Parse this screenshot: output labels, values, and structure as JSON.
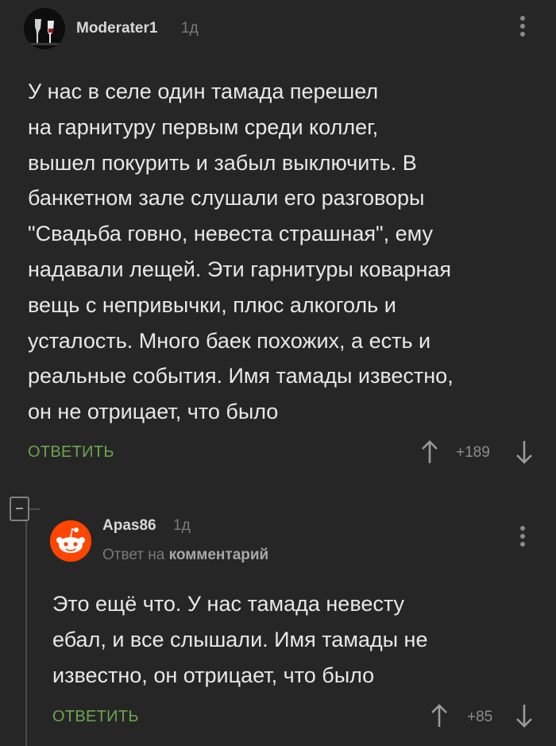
{
  "comments": [
    {
      "author": "Moderater1",
      "age": "1д",
      "text_lines": [
        "У нас в селе один тамада перешел",
        "на гарнитуру первым среди коллег,",
        "вышел покурить и забыл выключить. В",
        "банкетном зале слушали его разговоры",
        "\"Свадьба говно, невеста страшная\", ему",
        "надавали лещей. Эти гарнитуры коварная",
        "вещь с непривычки, плюс алкоголь и",
        "усталость. Много баек похожих, а есть и",
        "реальные события. Имя тамады известно,",
        "он не отрицает, что было"
      ],
      "reply_label": "ОТВЕТИТЬ",
      "score": "+189"
    },
    {
      "author": "Apas86",
      "age": "1д",
      "reply_to_prefix": "Ответ на",
      "reply_to_target": "комментарий",
      "text_lines": [
        "Это ещё что. У нас тамада невесту",
        "ебал, и все слышали. Имя тамады не",
        "известно, он отрицает, что было"
      ],
      "reply_label": "ОТВЕТИТЬ",
      "score": "+85"
    }
  ],
  "icons": {
    "upvote": "arrow-up-icon",
    "downvote": "arrow-down-icon",
    "more": "kebab-menu-icon",
    "collapse": "collapse-thread-icon"
  },
  "colors": {
    "background": "#262626",
    "accent_green": "#6ca54f",
    "reddit_orange": "#ff4500"
  }
}
